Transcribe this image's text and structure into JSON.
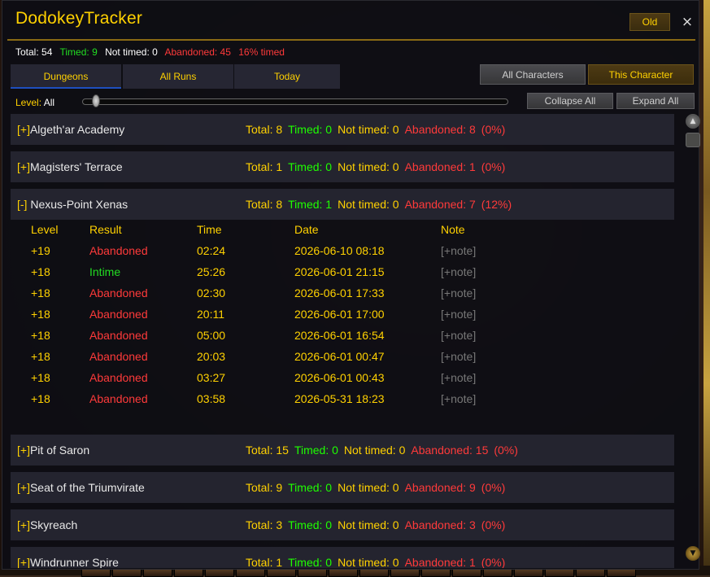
{
  "window": {
    "title": "DodokeyTracker",
    "old_label": "Old",
    "close_glyph": "×"
  },
  "summary": {
    "total": "Total: 54",
    "timed": "Timed: 9",
    "not_timed": "Not timed: 0",
    "abandoned": "Abandoned: 45",
    "percent": "16% timed"
  },
  "tabs": [
    {
      "label": "Dungeons"
    },
    {
      "label": "All Runs"
    },
    {
      "label": "Today"
    }
  ],
  "filters": {
    "all_characters": "All Characters",
    "this_character": "This Character"
  },
  "level_filter": {
    "label": "Level:",
    "value": "All"
  },
  "controls": {
    "collapse_all": "Collapse All",
    "expand_all": "Expand All"
  },
  "dungeons": [
    {
      "toggle": "[+]",
      "name": "Algeth'ar Academy",
      "total": "Total: 8",
      "timed": "Timed: 0",
      "not_timed": "Not timed: 0",
      "abandoned": "Abandoned: 8",
      "percent": "(0%)"
    },
    {
      "toggle": "[+]",
      "name": "Magisters' Terrace",
      "total": "Total: 1",
      "timed": "Timed: 0",
      "not_timed": "Not timed: 0",
      "abandoned": "Abandoned: 1",
      "percent": "(0%)"
    },
    {
      "toggle": "[-]",
      "name": "Nexus-Point Xenas",
      "total": "Total: 8",
      "timed": "Timed: 1",
      "not_timed": "Not timed: 0",
      "abandoned": "Abandoned: 7",
      "percent": "(12%)"
    },
    {
      "toggle": "[+]",
      "name": "Pit of Saron",
      "total": "Total: 15",
      "timed": "Timed: 0",
      "not_timed": "Not timed: 0",
      "abandoned": "Abandoned: 15",
      "percent": "(0%)"
    },
    {
      "toggle": "[+]",
      "name": "Seat of the Triumvirate",
      "total": "Total: 9",
      "timed": "Timed: 0",
      "not_timed": "Not timed: 0",
      "abandoned": "Abandoned: 9",
      "percent": "(0%)"
    },
    {
      "toggle": "[+]",
      "name": "Skyreach",
      "total": "Total: 3",
      "timed": "Timed: 0",
      "not_timed": "Not timed: 0",
      "abandoned": "Abandoned: 3",
      "percent": "(0%)"
    },
    {
      "toggle": "[+]",
      "name": "Windrunner Spire",
      "total": "Total: 1",
      "timed": "Timed: 0",
      "not_timed": "Not timed: 0",
      "abandoned": "Abandoned: 1",
      "percent": "(0%)"
    }
  ],
  "runs_table": {
    "headers": {
      "level": "Level",
      "result": "Result",
      "time": "Time",
      "date": "Date",
      "note": "Note"
    },
    "rows": [
      {
        "level": "+19",
        "result": "Abandoned",
        "status": "abandoned",
        "time": "02:24",
        "date": "2026-06-10 08:18",
        "note": "[+note]"
      },
      {
        "level": "+18",
        "result": "Intime",
        "status": "intime",
        "time": "25:26",
        "date": "2026-06-01 21:15",
        "note": "[+note]"
      },
      {
        "level": "+18",
        "result": "Abandoned",
        "status": "abandoned",
        "time": "02:30",
        "date": "2026-06-01 17:33",
        "note": "[+note]"
      },
      {
        "level": "+18",
        "result": "Abandoned",
        "status": "abandoned",
        "time": "20:11",
        "date": "2026-06-01 17:00",
        "note": "[+note]"
      },
      {
        "level": "+18",
        "result": "Abandoned",
        "status": "abandoned",
        "time": "05:00",
        "date": "2026-06-01 16:54",
        "note": "[+note]"
      },
      {
        "level": "+18",
        "result": "Abandoned",
        "status": "abandoned",
        "time": "20:03",
        "date": "2026-06-01 00:47",
        "note": "[+note]"
      },
      {
        "level": "+18",
        "result": "Abandoned",
        "status": "abandoned",
        "time": "03:27",
        "date": "2026-06-01 00:43",
        "note": "[+note]"
      },
      {
        "level": "+18",
        "result": "Abandoned",
        "status": "abandoned",
        "time": "03:58",
        "date": "2026-05-31 18:23",
        "note": "[+note]"
      }
    ]
  },
  "colors": {
    "gold": "#ffd100",
    "green": "#1eff00",
    "red": "#ff3a3a",
    "gray": "#777777",
    "tab_active_underline": "#1e4fbf"
  },
  "icons": {
    "close": "close-icon",
    "scroll_up": "scroll-up-icon",
    "scroll_down": "scroll-down-icon"
  }
}
